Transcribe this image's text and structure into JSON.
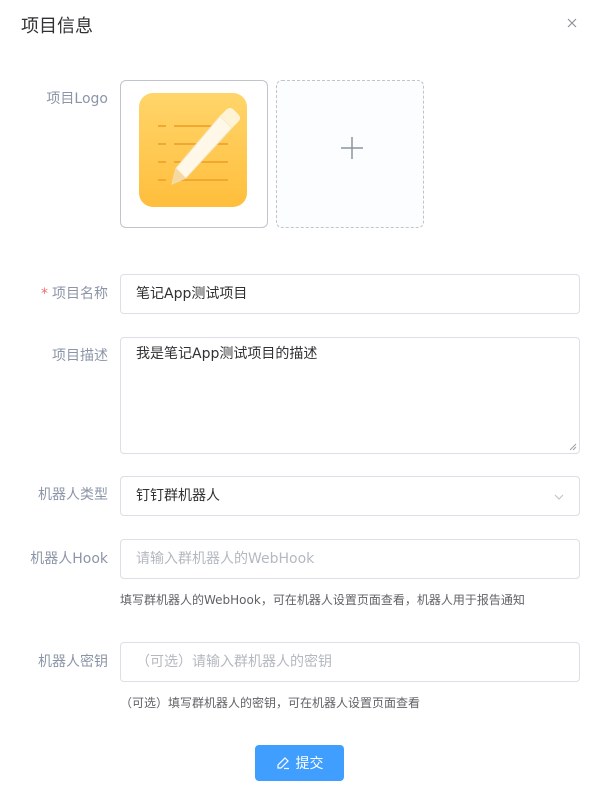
{
  "dialog": {
    "title": "项目信息"
  },
  "form": {
    "logo": {
      "label": "项目Logo"
    },
    "name": {
      "required_mark": "*",
      "label": "项目名称",
      "value": "笔记App测试项目"
    },
    "description": {
      "label": "项目描述",
      "value": "我是笔记App测试项目的描述"
    },
    "robot_type": {
      "label": "机器人类型",
      "value": "钉钉群机器人"
    },
    "hook": {
      "label": "机器人Hook",
      "placeholder": "请输入群机器人的WebHook",
      "help": "填写群机器人的WebHook，可在机器人设置页面查看，机器人用于报告通知"
    },
    "secret": {
      "label": "机器人密钥",
      "placeholder": "（可选）请输入群机器人的密钥",
      "help": "（可选）填写群机器人的密钥，可在机器人设置页面查看"
    }
  },
  "actions": {
    "submit_label": "提交"
  },
  "colors": {
    "primary": "#409eff",
    "required": "#f56c6c",
    "logo_yellow": "#ffc845"
  },
  "icons": [
    "close-icon",
    "notepad-pencil-logo",
    "plus-icon",
    "chevron-down-icon",
    "edit-icon"
  ]
}
